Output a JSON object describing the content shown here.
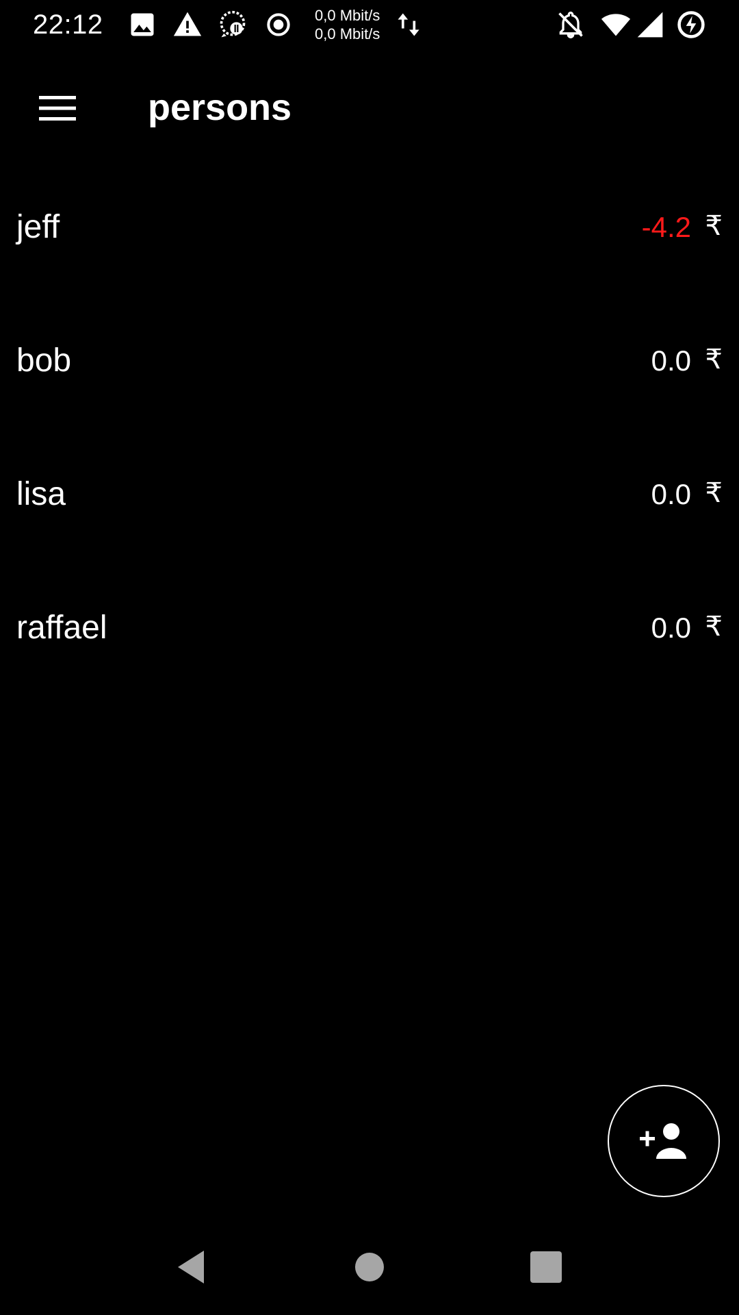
{
  "status_bar": {
    "time": "22:12",
    "net_speed_up": "0,0 Mbit/s",
    "net_speed_down": "0,0 Mbit/s",
    "icons": [
      "image-icon",
      "warning-icon",
      "chat-bubble-icon",
      "record-icon",
      "data-transfer-icon",
      "notifications-off-icon",
      "wifi-icon",
      "cell-signal-icon",
      "battery-saver-icon"
    ]
  },
  "app_bar": {
    "title": "persons",
    "menu_icon": "hamburger-menu-icon"
  },
  "persons": [
    {
      "name": "jeff",
      "amount": "-4.2",
      "currency": "₹",
      "negative": true
    },
    {
      "name": "bob",
      "amount": "0.0",
      "currency": "₹",
      "negative": false
    },
    {
      "name": "lisa",
      "amount": "0.0",
      "currency": "₹",
      "negative": false
    },
    {
      "name": "raffael",
      "amount": "0.0",
      "currency": "₹",
      "negative": false
    }
  ],
  "fab": {
    "icon": "add-person-icon"
  },
  "nav_bar": {
    "icons": [
      "back-icon",
      "home-icon",
      "recents-icon"
    ]
  },
  "colors": {
    "background": "#000000",
    "text": "#ffffff",
    "negative": "#ff1a1a",
    "nav_icon": "#a6a6a6"
  }
}
